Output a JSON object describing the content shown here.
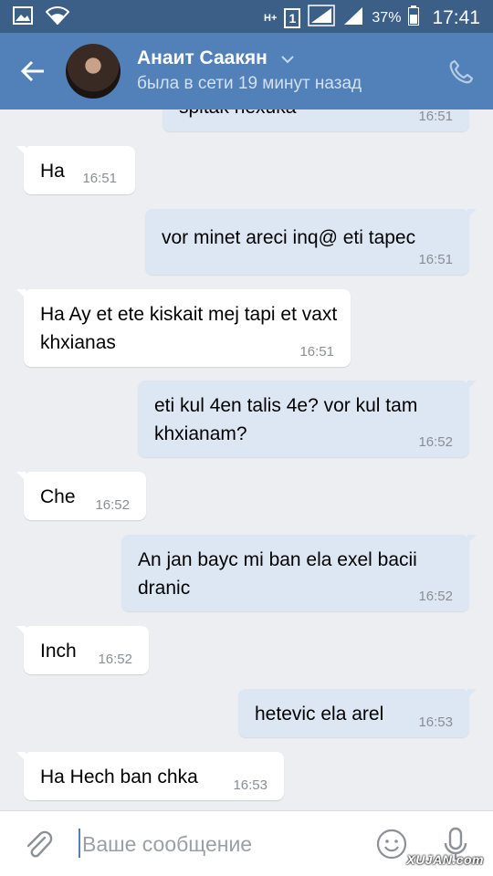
{
  "statusbar": {
    "network": "H+",
    "sim": "1",
    "battery_pct": "37%",
    "time": "17:41"
  },
  "header": {
    "name": "Анаит Саакян",
    "last_seen": "была в сети 19 минут назад"
  },
  "messages": [
    {
      "dir": "out",
      "text": "spitak nexuka",
      "time": "16:51"
    },
    {
      "dir": "in",
      "text": "Ha",
      "time": "16:51"
    },
    {
      "dir": "out",
      "text": "vor minet areci inq@ eti tapec",
      "time": "16:51"
    },
    {
      "dir": "in",
      "text": "Ha Ay et ete kiskait mej tapi et vaxt khxianas",
      "time": "16:51"
    },
    {
      "dir": "out",
      "text": "eti kul 4en talis 4e? vor kul tam khxianam?",
      "time": "16:52"
    },
    {
      "dir": "in",
      "text": "Che",
      "time": "16:52"
    },
    {
      "dir": "out",
      "text": "An jan bayc mi ban ela exel bacii dranic",
      "time": "16:52"
    },
    {
      "dir": "in",
      "text": "Inch",
      "time": "16:52"
    },
    {
      "dir": "out",
      "text": "hetevic ela arel",
      "time": "16:53"
    },
    {
      "dir": "in",
      "text": "Ha Hech ban chka",
      "time": "16:53"
    }
  ],
  "input": {
    "placeholder": "Ваше сообщение"
  },
  "watermark": "XUJAN.com",
  "colors": {
    "header": "#5181b8",
    "statusbar": "#3c5f88",
    "incoming": "#ffffff",
    "outgoing": "#dde7f4",
    "chat_bg": "#eceef1"
  },
  "icons": [
    "image-icon",
    "wifi-icon",
    "signal-icon",
    "battery-icon",
    "back-arrow-icon",
    "chevron-down-icon",
    "phone-icon",
    "paperclip-icon",
    "emoji-icon",
    "microphone-icon"
  ]
}
